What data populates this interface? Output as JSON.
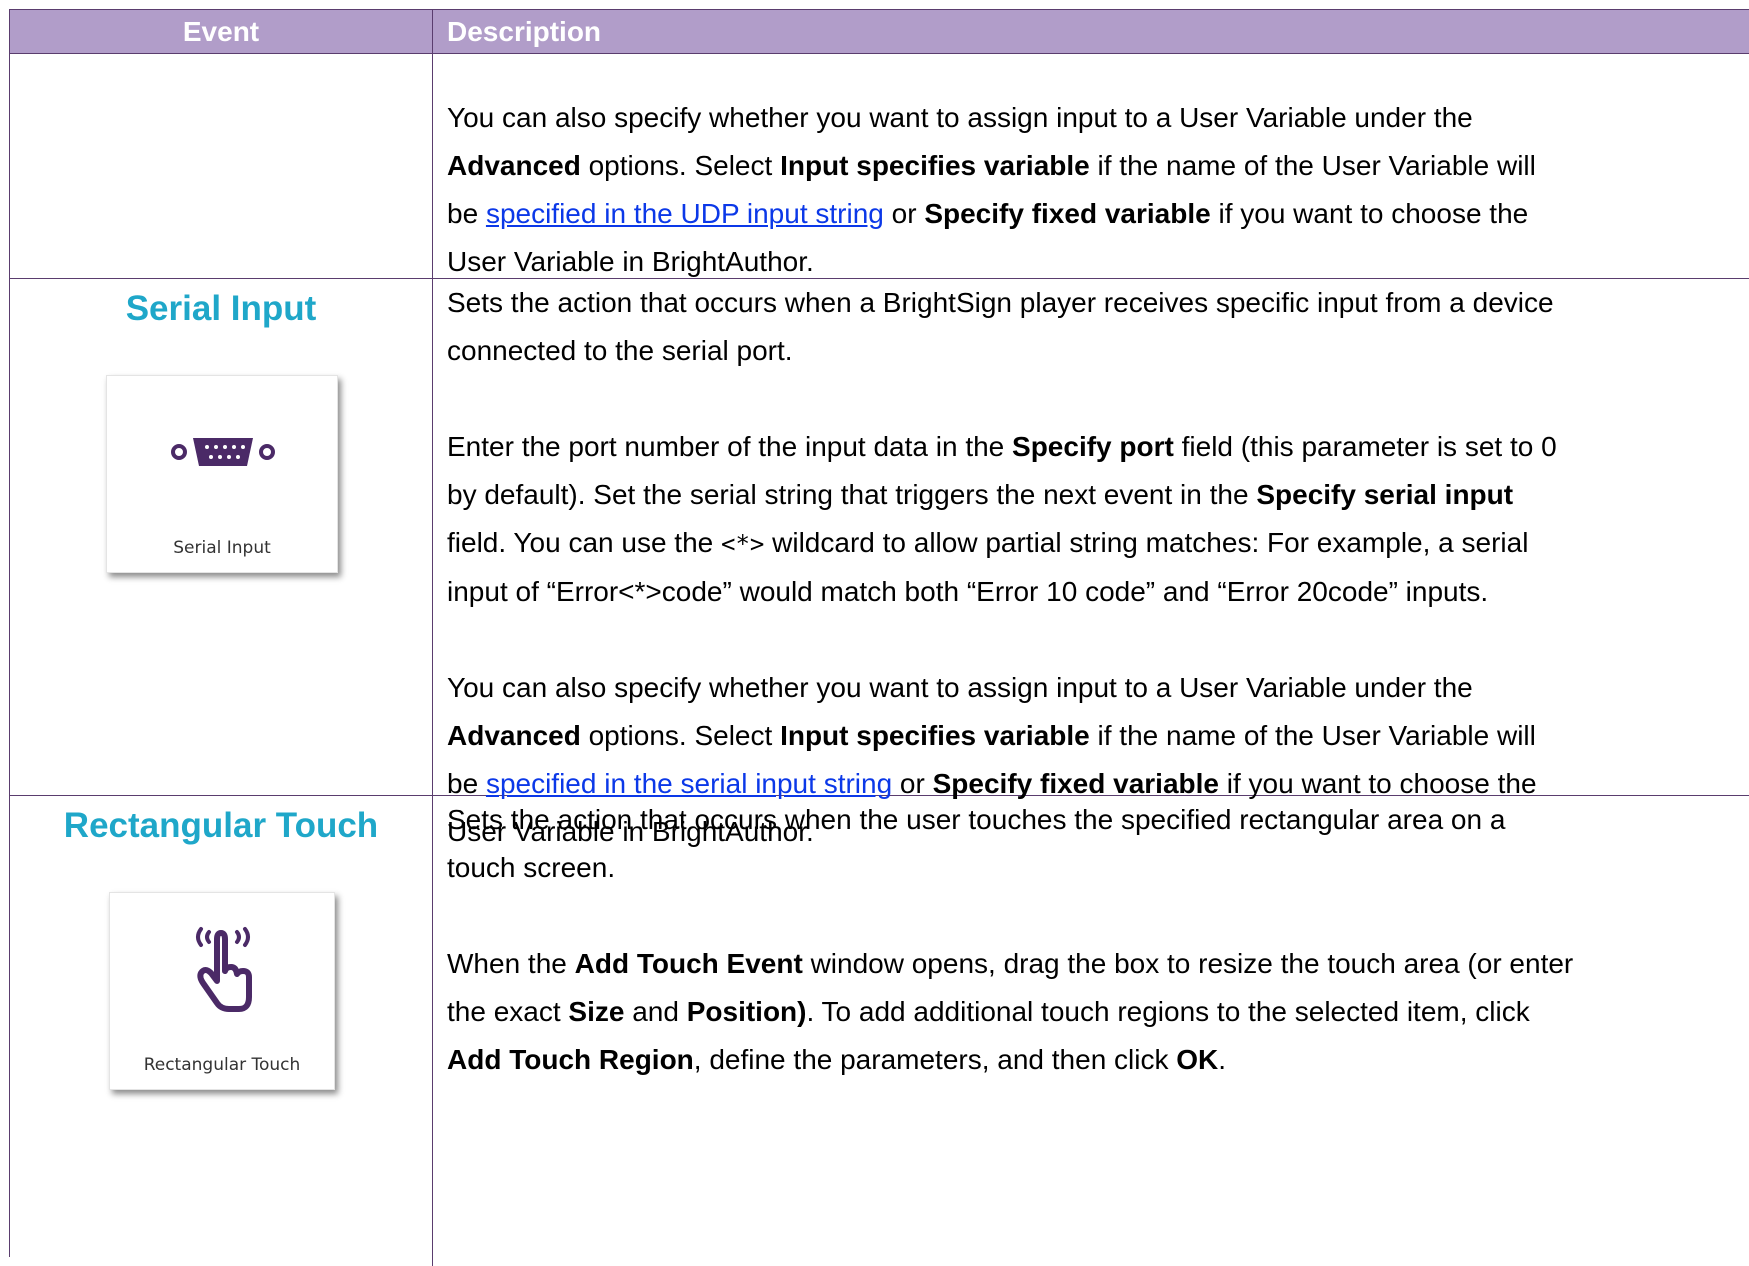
{
  "header": {
    "event": "Event",
    "description": "Description"
  },
  "row1": {
    "p1_a": "You can also specify whether you want to assign input to a User Variable under the",
    "p1_b_bold": "Advanced",
    "p1_b_rest": " options. Select ",
    "p1_b_bold2": "Input specifies variable",
    "p1_b_rest2": " if the name of the User Variable will",
    "p1_c_pre": "be ",
    "p1_c_link": "specified in the UDP input string",
    "p1_c_mid": " or ",
    "p1_c_bold": "Specify fixed variable",
    "p1_c_rest": " if you want to choose the",
    "p1_d": "User Variable in BrightAuthor."
  },
  "serial": {
    "title": "Serial Input",
    "card_label": "Serial Input",
    "icon": "serial-port-icon",
    "l1": "Sets the action that occurs when a BrightSign player receives specific input from a device",
    "l2": "connected to the serial port.",
    "l3_pre": "Enter the port number of the input data in the ",
    "l3_bold": "Specify port",
    "l3_rest": " field (this parameter is set to 0",
    "l4_pre": "by default). Set the serial string that triggers the next event in the ",
    "l4_bold": "Specify serial input",
    "l5_pre": "field. You can use the ",
    "l5_code": "<*>",
    "l5_rest": " wildcard to allow partial string matches: For example, a serial",
    "l6": "input of “Error<*>code” would match both “Error 10 code” and “Error 20code” inputs.",
    "l7": "You can also specify whether you want to assign input to a User Variable under the",
    "l8_bold": "Advanced",
    "l8_rest": " options. Select ",
    "l8_bold2": "Input specifies variable",
    "l8_rest2": " if the name of the User Variable will",
    "l9_pre": "be ",
    "l9_link": "specified in the serial input string",
    "l9_mid": " or ",
    "l9_bold": "Specify fixed variable",
    "l9_rest": " if you want to choose the",
    "l10": "User Variable in BrightAuthor."
  },
  "touch": {
    "title": "Rectangular Touch",
    "card_label": "Rectangular Touch",
    "icon": "touch-hand-icon",
    "l1": "Sets the action that occurs when the user touches the specified rectangular area on a",
    "l2": "touch screen.",
    "l3_pre": "When the ",
    "l3_bold": "Add Touch Event",
    "l3_rest": " window opens, drag the box to resize the touch area (or enter",
    "l4_pre": "the exact ",
    "l4_bold": "Size",
    "l4_mid": " and ",
    "l4_bold2": "Position)",
    "l4_rest": ". To add additional touch regions to the selected item, click",
    "l5_bold": "Add Touch Region",
    "l5_rest": ", define the parameters, and then click ",
    "l5_bold2": "OK",
    "l5_end": "."
  }
}
